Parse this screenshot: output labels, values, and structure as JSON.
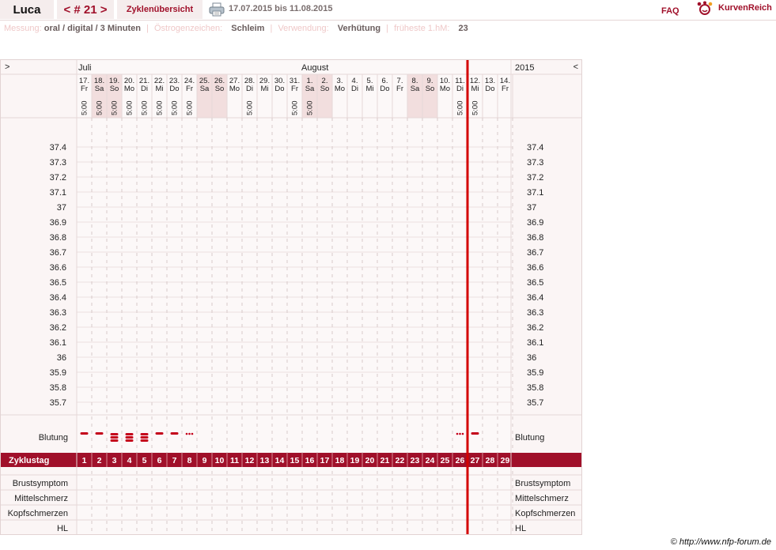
{
  "header": {
    "name": "Luca",
    "cycle_label": "< # 21 >",
    "overview_label": "Zyklenübersicht",
    "date_range": "17.07.2015 bis 11.08.2015",
    "faq_label": "FAQ",
    "brand": "KurvenReich"
  },
  "info": {
    "measurement_label": "Messung:",
    "measurement_value": "oral / digital / 3 Minuten",
    "estrogen_label": "Östrogenzeichen:",
    "estrogen_value": "Schleim",
    "usage_label": "Verwendung:",
    "usage_value": "Verhütung",
    "earliest_label": "früheste 1.hM:",
    "earliest_value": "23",
    "separator": "|"
  },
  "nav": {
    "prev": ">",
    "next": "<",
    "year": "2015"
  },
  "months": [
    {
      "label": "Juli",
      "day_index": 0
    },
    {
      "label": "August",
      "day_index": 15
    }
  ],
  "days": [
    {
      "date": "17.",
      "weekday": "Fr",
      "time": "5:00",
      "cycle_day": "1",
      "bleeding": "light",
      "weekend": false
    },
    {
      "date": "18.",
      "weekday": "Sa",
      "time": "5:00",
      "cycle_day": "2",
      "bleeding": "light",
      "weekend": true
    },
    {
      "date": "19.",
      "weekday": "So",
      "time": "5:00",
      "cycle_day": "3",
      "bleeding": "heavy",
      "weekend": true
    },
    {
      "date": "20.",
      "weekday": "Mo",
      "time": "5:00",
      "cycle_day": "4",
      "bleeding": "heavy",
      "weekend": false
    },
    {
      "date": "21.",
      "weekday": "Di",
      "time": "5:00",
      "cycle_day": "5",
      "bleeding": "heavy",
      "weekend": false
    },
    {
      "date": "22.",
      "weekday": "Mi",
      "time": "5:00",
      "cycle_day": "6",
      "bleeding": "light",
      "weekend": false
    },
    {
      "date": "23.",
      "weekday": "Do",
      "time": "5:00",
      "cycle_day": "7",
      "bleeding": "light",
      "weekend": false
    },
    {
      "date": "24.",
      "weekday": "Fr",
      "time": "5:00",
      "cycle_day": "8",
      "bleeding": "spotting",
      "weekend": false
    },
    {
      "date": "25.",
      "weekday": "Sa",
      "time": "",
      "cycle_day": "9",
      "bleeding": "",
      "weekend": true
    },
    {
      "date": "26.",
      "weekday": "So",
      "time": "",
      "cycle_day": "10",
      "bleeding": "",
      "weekend": true
    },
    {
      "date": "27.",
      "weekday": "Mo",
      "time": "",
      "cycle_day": "11",
      "bleeding": "",
      "weekend": false
    },
    {
      "date": "28.",
      "weekday": "Di",
      "time": "5:00",
      "cycle_day": "12",
      "bleeding": "",
      "weekend": false
    },
    {
      "date": "29.",
      "weekday": "Mi",
      "time": "",
      "cycle_day": "13",
      "bleeding": "",
      "weekend": false
    },
    {
      "date": "30.",
      "weekday": "Do",
      "time": "",
      "cycle_day": "14",
      "bleeding": "",
      "weekend": false
    },
    {
      "date": "31.",
      "weekday": "Fr",
      "time": "5:00",
      "cycle_day": "15",
      "bleeding": "",
      "weekend": false
    },
    {
      "date": "1.",
      "weekday": "Sa",
      "time": "5:00",
      "cycle_day": "16",
      "bleeding": "",
      "weekend": true
    },
    {
      "date": "2.",
      "weekday": "So",
      "time": "",
      "cycle_day": "17",
      "bleeding": "",
      "weekend": true
    },
    {
      "date": "3.",
      "weekday": "Mo",
      "time": "",
      "cycle_day": "18",
      "bleeding": "",
      "weekend": false
    },
    {
      "date": "4.",
      "weekday": "Di",
      "time": "",
      "cycle_day": "19",
      "bleeding": "",
      "weekend": false
    },
    {
      "date": "5.",
      "weekday": "Mi",
      "time": "",
      "cycle_day": "20",
      "bleeding": "",
      "weekend": false
    },
    {
      "date": "6.",
      "weekday": "Do",
      "time": "",
      "cycle_day": "21",
      "bleeding": "",
      "weekend": false
    },
    {
      "date": "7.",
      "weekday": "Fr",
      "time": "",
      "cycle_day": "22",
      "bleeding": "",
      "weekend": false
    },
    {
      "date": "8.",
      "weekday": "Sa",
      "time": "",
      "cycle_day": "23",
      "bleeding": "",
      "weekend": true
    },
    {
      "date": "9.",
      "weekday": "So",
      "time": "",
      "cycle_day": "24",
      "bleeding": "",
      "weekend": true
    },
    {
      "date": "10.",
      "weekday": "Mo",
      "time": "",
      "cycle_day": "25",
      "bleeding": "",
      "weekend": false
    },
    {
      "date": "11.",
      "weekday": "Di",
      "time": "5:00",
      "cycle_day": "26",
      "bleeding": "spotting",
      "weekend": false
    },
    {
      "date": "12.",
      "weekday": "Mi",
      "time": "5:00",
      "cycle_day": "27",
      "bleeding": "light",
      "weekend": false
    },
    {
      "date": "13.",
      "weekday": "Do",
      "time": "",
      "cycle_day": "28",
      "bleeding": "",
      "weekend": false
    },
    {
      "date": "14.",
      "weekday": "Fr",
      "time": "",
      "cycle_day": "29",
      "bleeding": "",
      "weekend": false
    }
  ],
  "current_day_index": 25,
  "temperature_scale": [
    "37.4",
    "37.3",
    "37.2",
    "37.1",
    "37",
    "36.9",
    "36.8",
    "36.7",
    "36.6",
    "36.5",
    "36.4",
    "36.3",
    "36.2",
    "36.1",
    "36",
    "35.9",
    "35.8",
    "35.7"
  ],
  "rows": {
    "bleeding_label": "Blutung",
    "cycle_day_label": "Zyklustag",
    "symptoms": [
      "Brustsymptom",
      "Mittelschmerz",
      "Kopfschmerzen",
      "HL"
    ]
  },
  "colors": {
    "accent": "#a0102a",
    "weekend": "#f2dede",
    "bleeding": "#c4001a",
    "current_line": "#d40000"
  },
  "footer": {
    "credit": "© http://www.nfp-forum.de"
  }
}
